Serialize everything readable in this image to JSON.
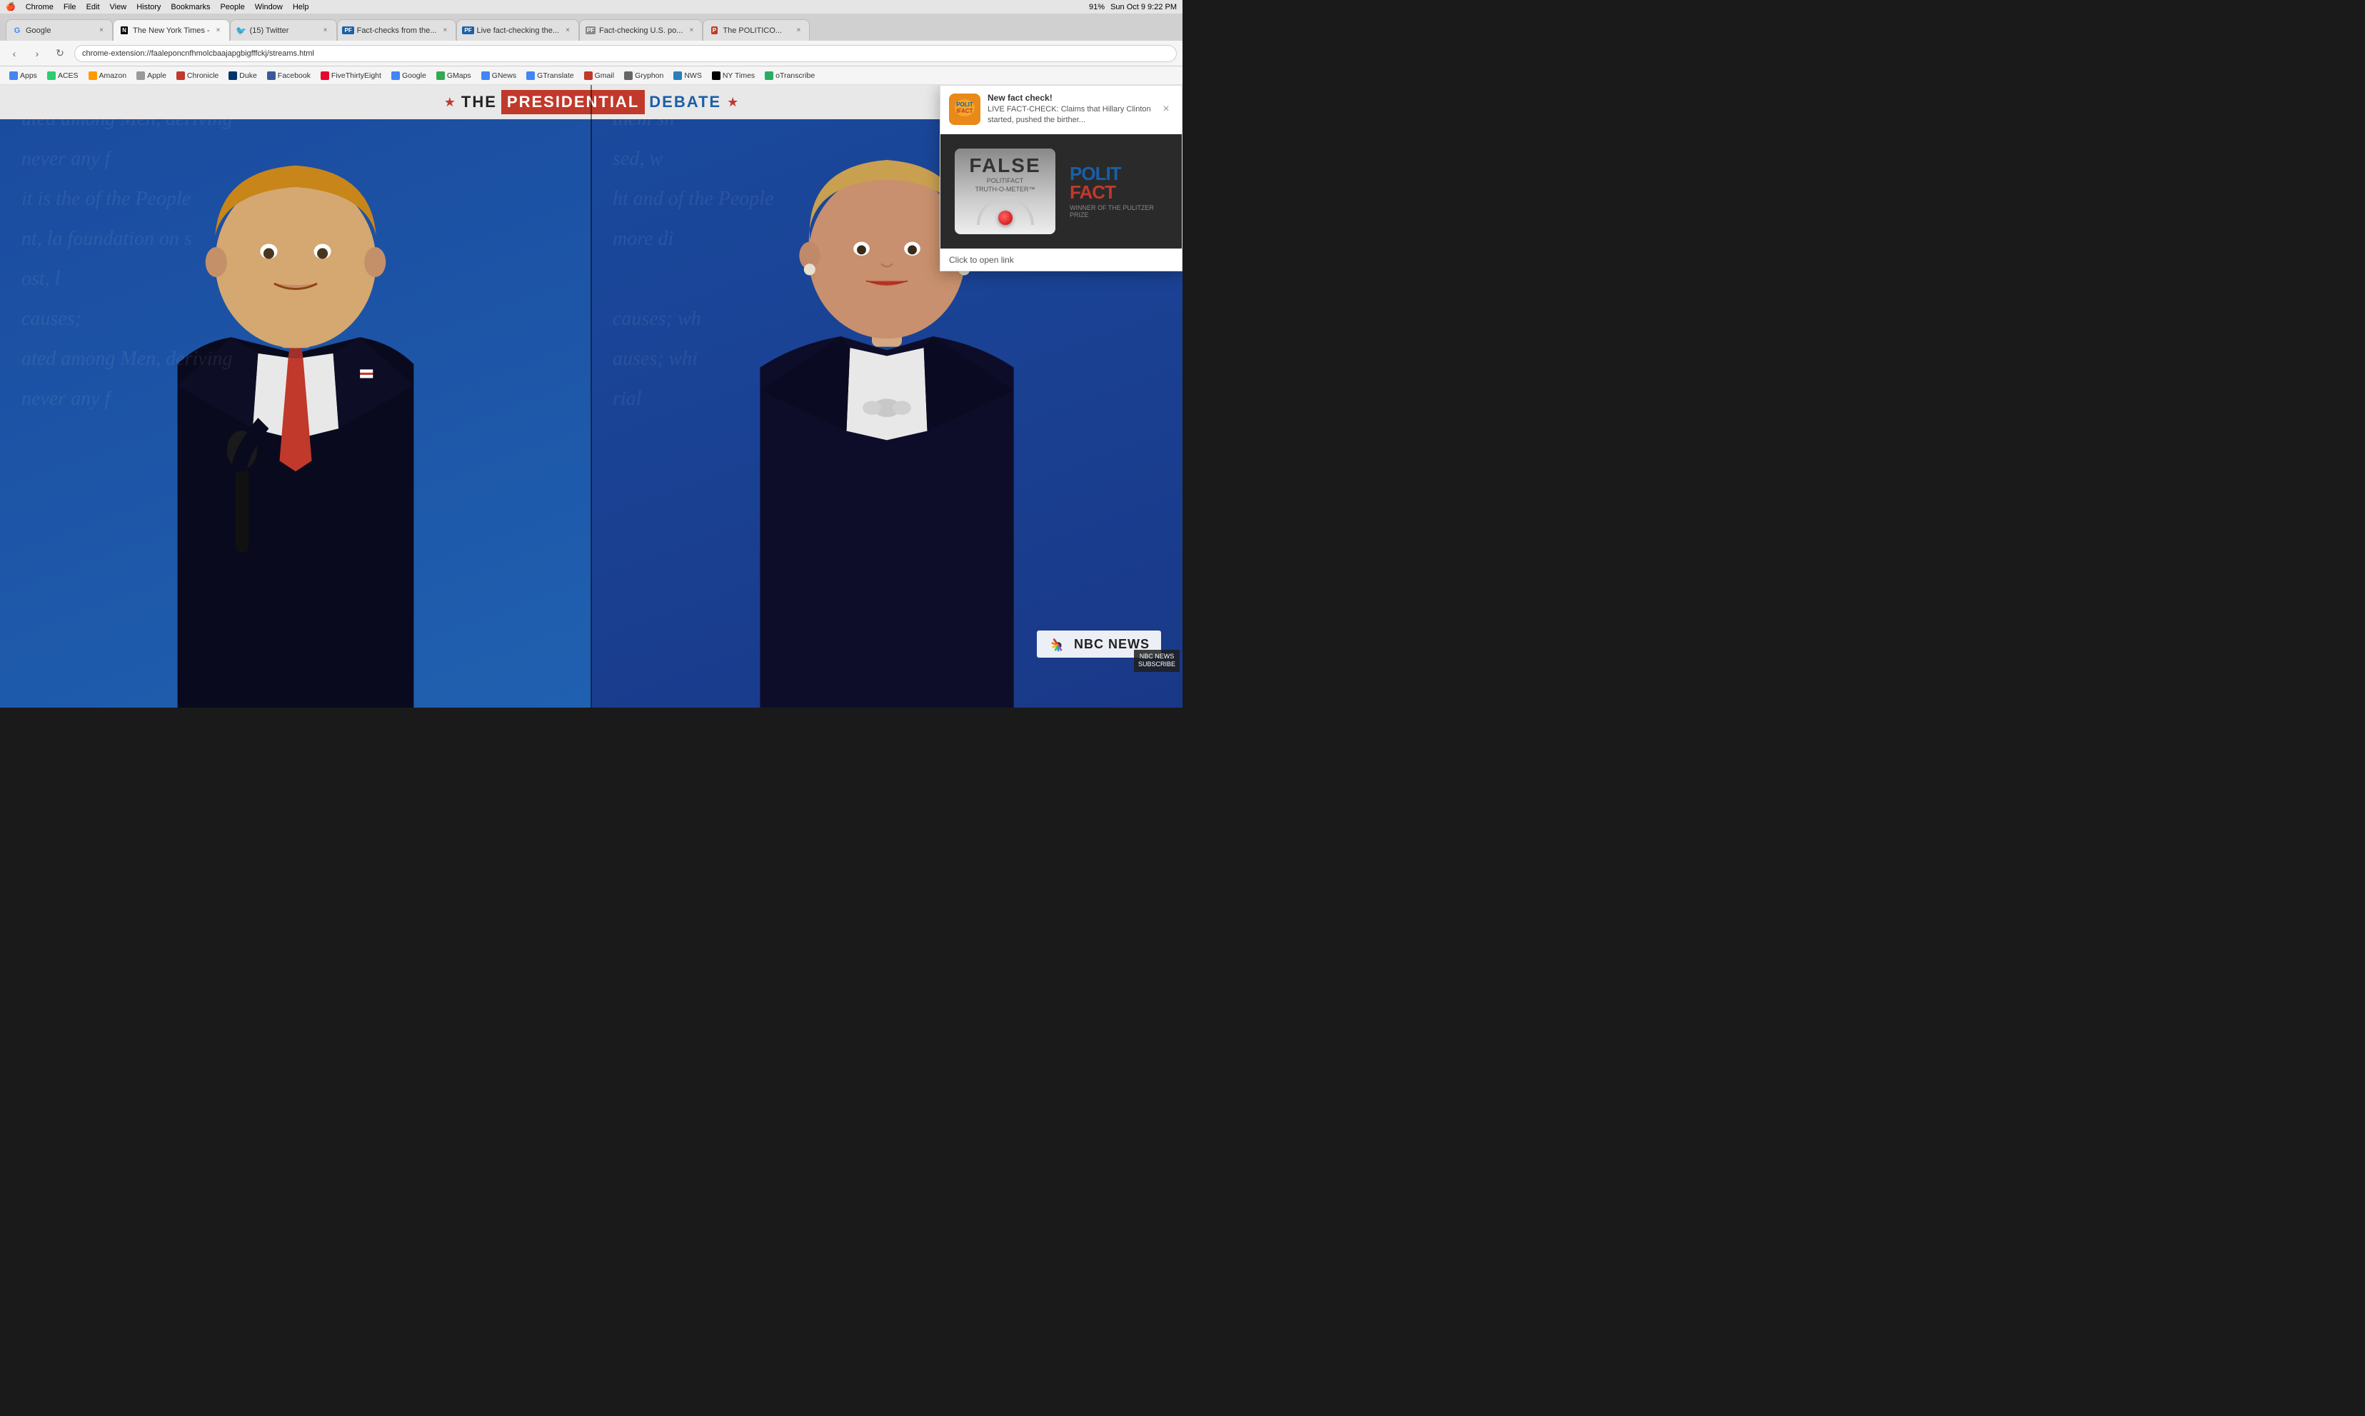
{
  "menubar": {
    "apple": "🍎",
    "items": [
      "Chrome",
      "File",
      "Edit",
      "View",
      "History",
      "Bookmarks",
      "People",
      "Window",
      "Help"
    ],
    "right": {
      "battery": "91%",
      "time": "Sun Oct 9  9:22 PM"
    }
  },
  "tabs": [
    {
      "id": "google",
      "label": "Google",
      "favicon_type": "google",
      "favicon_text": "G",
      "active": false
    },
    {
      "id": "nyt",
      "label": "The New York Times - ",
      "favicon_type": "nyt",
      "favicon_text": "N",
      "active": true
    },
    {
      "id": "twitter",
      "label": "(15) Twitter",
      "favicon_type": "twitter",
      "favicon_text": "t",
      "active": false
    },
    {
      "id": "factchecks",
      "label": "Fact-checks from the...",
      "favicon_type": "pf",
      "favicon_text": "PF",
      "active": false
    },
    {
      "id": "livefact",
      "label": "Live fact-checking the...",
      "favicon_type": "pf",
      "favicon_text": "PF",
      "active": false
    },
    {
      "id": "factchecking",
      "label": "Fact-checking U.S. po...",
      "favicon_type": "pf3",
      "favicon_text": "PF",
      "active": false
    },
    {
      "id": "politico",
      "label": "The POLITICO...",
      "favicon_type": "pf2",
      "favicon_text": "P",
      "active": false
    }
  ],
  "addressbar": {
    "url": "chrome-extension://faaleponcnfhmolcbaajapgbigfffckj/streams.html"
  },
  "bookmarks": [
    {
      "label": "Apps",
      "color": "#4285f4"
    },
    {
      "label": "ACES",
      "color": "#2ecc71"
    },
    {
      "label": "Amazon",
      "color": "#ff9900"
    },
    {
      "label": "Apple",
      "color": "#999"
    },
    {
      "label": "Chronicle",
      "color": "#c0392b"
    },
    {
      "label": "Duke",
      "color": "#00356b"
    },
    {
      "label": "Facebook",
      "color": "#3b5998"
    },
    {
      "label": "FiveThirtyEight",
      "color": "#e8072f"
    },
    {
      "label": "Google",
      "color": "#4285f4"
    },
    {
      "label": "GMaps",
      "color": "#34a853"
    },
    {
      "label": "GNews",
      "color": "#4285f4"
    },
    {
      "label": "GTranslate",
      "color": "#4285f4"
    },
    {
      "label": "Gmail",
      "color": "#c0392b"
    },
    {
      "label": "Gryphon",
      "color": "#666"
    },
    {
      "label": "NWS",
      "color": "#2980b9"
    },
    {
      "label": "NY Times",
      "color": "#000"
    },
    {
      "label": "oTranscribe",
      "color": "#27ae60"
    }
  ],
  "video": {
    "left_person": "Donald Trump",
    "right_person": "Hillary Clinton",
    "network": "NBC NEWS",
    "event": "THE PRESIDENTIAL DEBATE"
  },
  "banner": {
    "star_left": "★",
    "the": "THE",
    "presidential": "PRESIDENTIAL",
    "debate": "DEBATE",
    "star_right": "★"
  },
  "nbc": {
    "name": "NBC NEWS",
    "subscribe": "NBC NEWS\nSUBSCRIBE"
  },
  "notification": {
    "title": "New fact check!",
    "logo_text": "POLITIFACT",
    "body": "LIVE FACT-CHECK: Claims that Hillary Clinton started, pushed the birther...",
    "image_alt": "FALSE - PolitiFact Truth-O-Meter",
    "meter_label": "FALSE",
    "meter_brand_line1": "POLITIFACT",
    "meter_brand_line2": "TRUTH-O-METER™",
    "pf_logo_left": "POLIT",
    "pf_logo_right": "FACT",
    "pf_pulitzer": "WINNER OF THE PULITZER PRIZE",
    "link_text": "Click to open link",
    "close_btn": "×"
  }
}
